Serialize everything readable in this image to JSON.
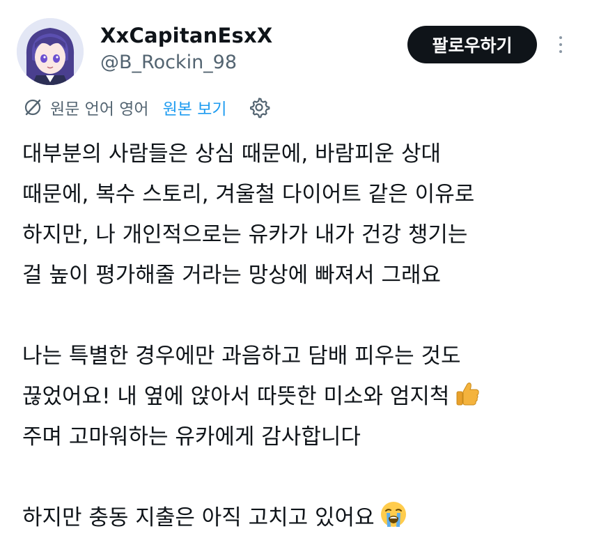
{
  "user": {
    "display_name": "XxCapitanEsxX",
    "handle": "@B_Rockin_98",
    "avatar": "anime-character-avatar"
  },
  "header": {
    "follow_label": "팔로우하기",
    "more_icon": "more-vertical-icon"
  },
  "translation": {
    "icon": "globe-slash-icon",
    "source_language": "원문 언어 영어",
    "view_original": "원본 보기",
    "settings_icon": "gear-icon"
  },
  "tweet": {
    "paragraph1": [
      "대부분의 사람들은 상심 때문에, 바람피운 상대",
      "때문에, 복수 스토리, 겨울철 다이어트 같은 이유로",
      "하지만, 나 개인적으로는 유카가 내가 건강 챙기는",
      "걸 높이 평가해줄 거라는 망상에 빠져서 그래요"
    ],
    "paragraph2": [
      "나는 특별한 경우에만 과음하고 담배 피우는 것도",
      "끊었어요! 내 옆에 앉아서 따뜻한 미소와 엄지척",
      "주며 고마워하는 유카에게 감사합니다"
    ],
    "paragraph3": [
      "하지만 충동 지출은 아직 고치고 있어요"
    ],
    "emojis": {
      "thumbs_up": "thumbs-up-emoji",
      "crying": "loudly-crying-face-emoji"
    }
  },
  "colors": {
    "text": "#0f1419",
    "secondary_text": "#536471",
    "link": "#1d9bf0",
    "button_bg": "#0f1419",
    "button_text": "#ffffff"
  }
}
